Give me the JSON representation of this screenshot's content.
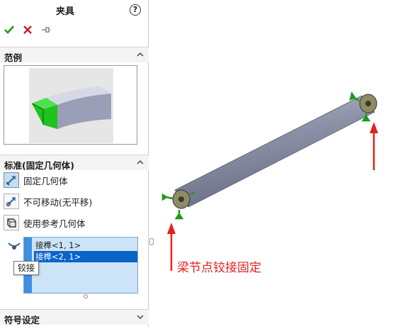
{
  "panel": {
    "title": "夹具",
    "help_glyph": "?",
    "actions": [
      "ok-icon",
      "cancel-icon",
      "pin-icon"
    ]
  },
  "example_section": {
    "label": "范例"
  },
  "standard_section": {
    "label": "标准(固定几何体)",
    "options": [
      {
        "label": "固定几何体",
        "selected": true
      },
      {
        "label": "不可移动(无平移)",
        "selected": false
      },
      {
        "label": "使用参考几何体",
        "selected": false
      }
    ]
  },
  "selection": {
    "items": [
      "接榫<1, 1>",
      "接榫<2, 1>"
    ],
    "active_index": 1,
    "tooltip": "铰接"
  },
  "symbol_section": {
    "label": "符号设定"
  },
  "annotation": {
    "text": "梁节点铰接固定",
    "color": "#e62020"
  },
  "colors": {
    "selection_blue": "#0a64c8",
    "beam_gray": "#8e92a8",
    "fixture_green": "#1a9a1a",
    "arrow_red": "#e62020"
  }
}
